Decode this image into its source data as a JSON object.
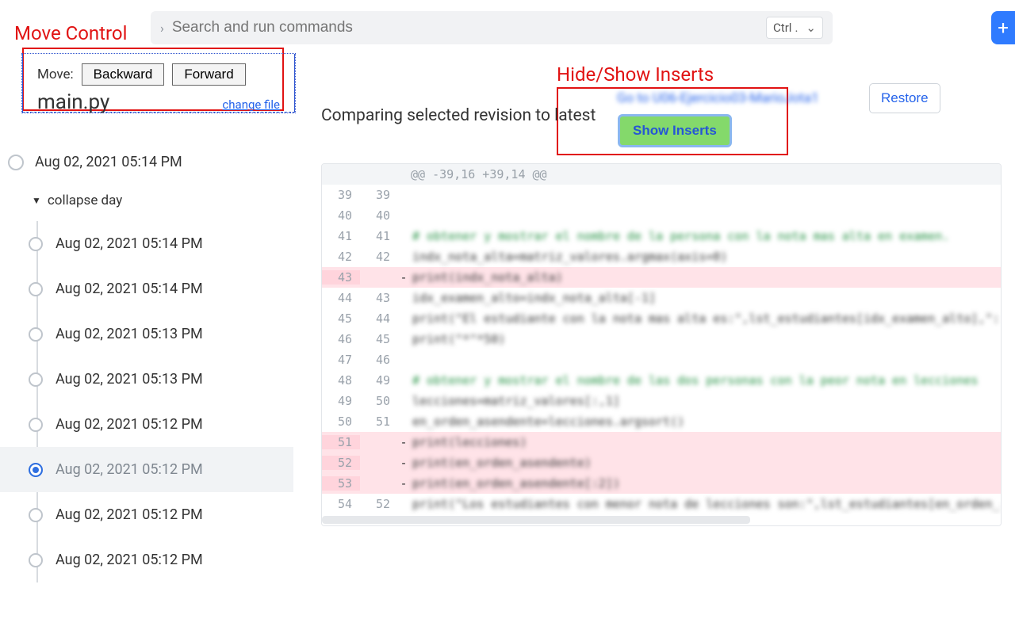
{
  "topbar": {
    "search_placeholder": "Search and run commands",
    "shortcut_key1": "Ctrl",
    "shortcut_key2": "."
  },
  "annotations": {
    "move_control": "Move Control",
    "hide_show_inserts": "Hide/Show Inserts"
  },
  "move_control": {
    "label": "Move:",
    "backward": "Backward",
    "forward": "Forward",
    "filename": "main.py",
    "change_file": "change file"
  },
  "compare": {
    "title": "Comparing selected revision to latest",
    "goto": "Go to U06-Ejercicio03-MarioJota1",
    "restore": "Restore",
    "show_inserts": "Show Inserts"
  },
  "timeline": {
    "header": "Aug 02, 2021 05:14 PM",
    "collapse": "collapse day",
    "revisions": [
      {
        "label": "Aug 02, 2021 05:14 PM",
        "selected": false
      },
      {
        "label": "Aug 02, 2021 05:14 PM",
        "selected": false
      },
      {
        "label": "Aug 02, 2021 05:13 PM",
        "selected": false
      },
      {
        "label": "Aug 02, 2021 05:13 PM",
        "selected": false
      },
      {
        "label": "Aug 02, 2021 05:12 PM",
        "selected": false
      },
      {
        "label": "Aug 02, 2021 05:12 PM",
        "selected": true
      },
      {
        "label": "Aug 02, 2021 05:12 PM",
        "selected": false
      },
      {
        "label": "Aug 02, 2021 05:12 PM",
        "selected": false
      }
    ]
  },
  "diff": {
    "hunk": "@@ -39,16 +39,14 @@",
    "rows": [
      {
        "l": "39",
        "r": "39",
        "t": "ctx",
        "c": ""
      },
      {
        "l": "40",
        "r": "40",
        "t": "ctx",
        "c": ""
      },
      {
        "l": "41",
        "r": "41",
        "t": "add",
        "c": "# obtener y mostrar el nombre de la persona con la nota mas alta en examen."
      },
      {
        "l": "42",
        "r": "42",
        "t": "ctx",
        "c": "indx_nota_alta=matriz_valores.argmax(axis=0)"
      },
      {
        "l": "43",
        "r": "",
        "t": "del",
        "c": "print(indx_nota_alta)"
      },
      {
        "l": "44",
        "r": "43",
        "t": "ctx",
        "c": "idx_examen_alto=indx_nota_alta[-1]"
      },
      {
        "l": "45",
        "r": "44",
        "t": "ctx",
        "c": "print(\"El estudiante con la nota mas alta es:\",lst_estudiantes[idx_examen_alto],\":"
      },
      {
        "l": "46",
        "r": "45",
        "t": "ctx",
        "c": "print(\"*\"*50)"
      },
      {
        "l": "47",
        "r": "46",
        "t": "ctx",
        "c": ""
      },
      {
        "l": "48",
        "r": "49",
        "t": "add",
        "c": "# obtener y mostrar el nombre de las dos personas con la peor nota en lecciones"
      },
      {
        "l": "49",
        "r": "50",
        "t": "ctx",
        "c": "lecciones=matriz_valores[:,1]"
      },
      {
        "l": "50",
        "r": "51",
        "t": "ctx",
        "c": "en_orden_asendente=lecciones.argsort()"
      },
      {
        "l": "51",
        "r": "",
        "t": "del",
        "c": "print(lecciones)"
      },
      {
        "l": "52",
        "r": "",
        "t": "del",
        "c": "print(en_orden_asendente)"
      },
      {
        "l": "53",
        "r": "",
        "t": "del",
        "c": "print(en_orden_asendente[:2])"
      },
      {
        "l": "54",
        "r": "52",
        "t": "ctx",
        "c": "print(\"Los estudiantes con menor nota de lecciones son:\",lst_estudiantes[en_orden_a"
      }
    ]
  }
}
